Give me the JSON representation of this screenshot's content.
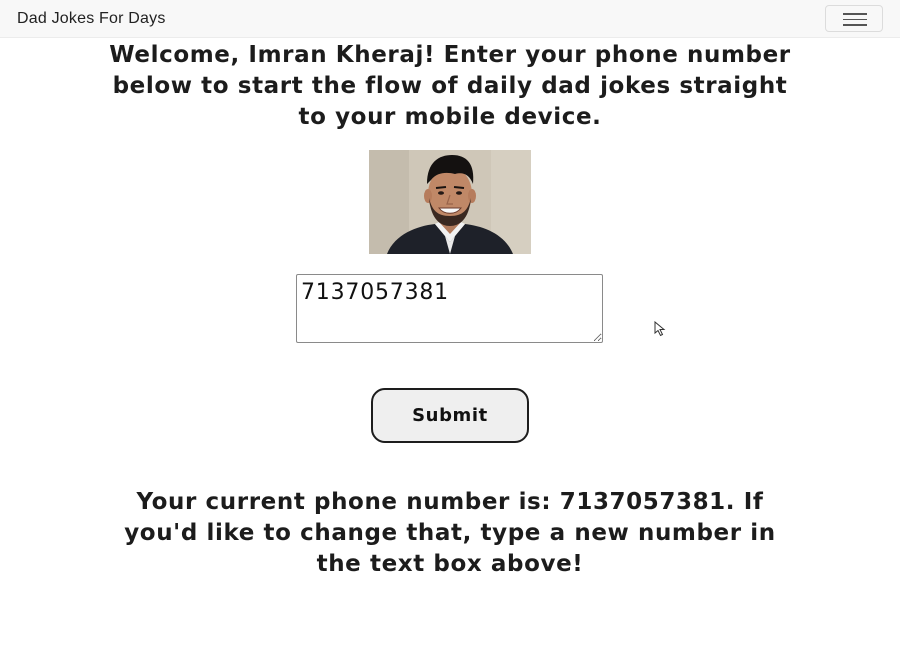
{
  "navbar": {
    "brand": "Dad Jokes For Days",
    "menu_icon": "hamburger-menu-icon"
  },
  "main": {
    "welcome_text": "Welcome, Imran Kheraj! Enter your phone number below to start the flow of daily dad jokes straight to your mobile device.",
    "profile_image": "profile-photo",
    "phone_input_value": "7137057381",
    "submit_label": "Submit",
    "current_number_text": "Your current phone number is: 7137057381. If you'd like to change that, type a new number in the text box above!"
  },
  "colors": {
    "navbar_bg": "#f8f8f8",
    "text": "#1c1c1c",
    "button_bg": "#efefef"
  }
}
